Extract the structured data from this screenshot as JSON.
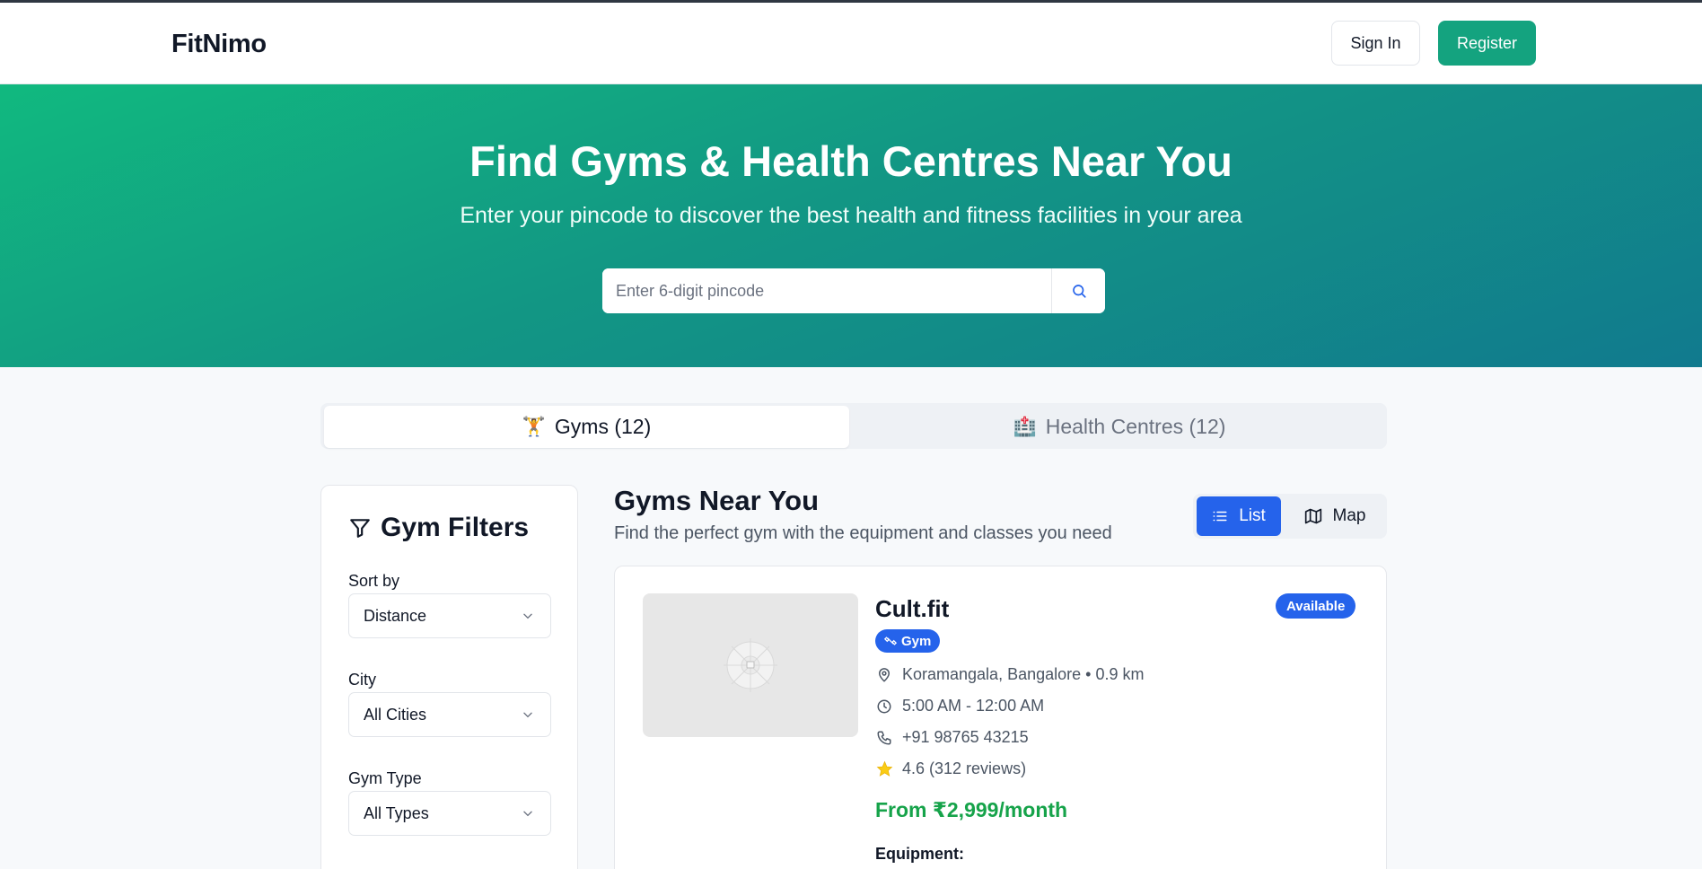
{
  "header": {
    "logo": "FitNimo",
    "signin_label": "Sign In",
    "register_label": "Register"
  },
  "hero": {
    "title": "Find Gyms & Health Centres Near You",
    "subtitle": "Enter your pincode to discover the best health and fitness facilities in your area",
    "search_placeholder": "Enter 6-digit pincode",
    "search_icon": "search-icon"
  },
  "tabs": [
    {
      "emoji": "🏋️",
      "label": "Gyms (12)",
      "active": true
    },
    {
      "emoji": "🏥",
      "label": "Health Centres (12)",
      "active": false
    }
  ],
  "filters": {
    "title": "Gym Filters",
    "icon": "filter-icon",
    "sort_label": "Sort by",
    "sort_value": "Distance",
    "city_label": "City",
    "city_value": "All Cities",
    "type_label": "Gym Type",
    "type_value": "All Types"
  },
  "main": {
    "heading": "Gyms Near You",
    "subheading": "Find the perfect gym with the equipment and classes you need",
    "view_list_label": "List",
    "view_map_label": "Map"
  },
  "listing": {
    "name": "Cult.fit",
    "status": "Available",
    "type": "Gym",
    "location": "Koramangala, Bangalore • 0.9 km",
    "hours": "5:00 AM - 12:00 AM",
    "phone": "+91 98765 43215",
    "rating": "4.6 (312 reviews)",
    "price": "From ₹2,999/month",
    "equipment_label": "Equipment:"
  },
  "colors": {
    "brand_green": "#14a37f",
    "accent_blue": "#2563eb",
    "price_green": "#16a34a",
    "star_yellow": "#facc15"
  }
}
